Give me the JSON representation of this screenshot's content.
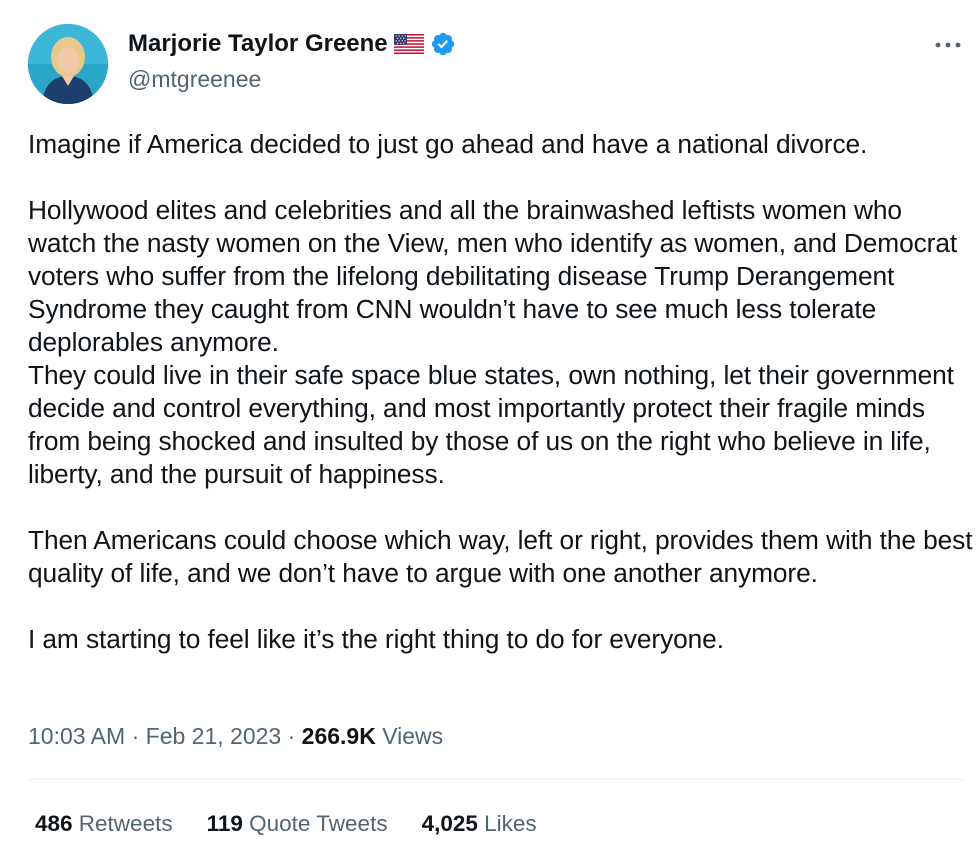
{
  "author": {
    "display_name": "Marjorie Taylor Greene",
    "handle": "@mtgreenee",
    "flag": "us-flag-icon",
    "verified": "verified-badge-icon"
  },
  "tweet": {
    "paragraphs": [
      "Imagine if America decided to just go ahead and have a national divorce.",
      "Hollywood elites and celebrities and all the brainwashed leftists women who watch the nasty women on the View, men who identify as women, and Democrat voters who suffer from the lifelong debilitating disease Trump Derangement Syndrome they caught from CNN wouldn’t have to see much less tolerate deplorables anymore.\nThey could live in their safe space blue states, own nothing, let their government decide and control everything, and most importantly protect their fragile minds from being shocked and insulted by those of us on the right who believe in life, liberty, and the pursuit of happiness.",
      "Then Americans could choose which way, left or right, provides them with the best quality of life, and we don’t have to argue with one another anymore.",
      "I am starting to feel like it’s the right thing to do for everyone."
    ]
  },
  "meta": {
    "time": "10:03 AM",
    "separator": " · ",
    "date": "Feb 21, 2023",
    "views_count": "266.9K",
    "views_label": " Views"
  },
  "stats": {
    "retweets_count": "486",
    "retweets_label": " Retweets",
    "quotes_count": "119",
    "quotes_label": " Quote Tweets",
    "likes_count": "4,025",
    "likes_label": " Likes"
  },
  "colors": {
    "primary_text": "#0f1419",
    "secondary_text": "#536471",
    "verified_blue": "#1d9bf0",
    "divider": "#eff3f4"
  }
}
